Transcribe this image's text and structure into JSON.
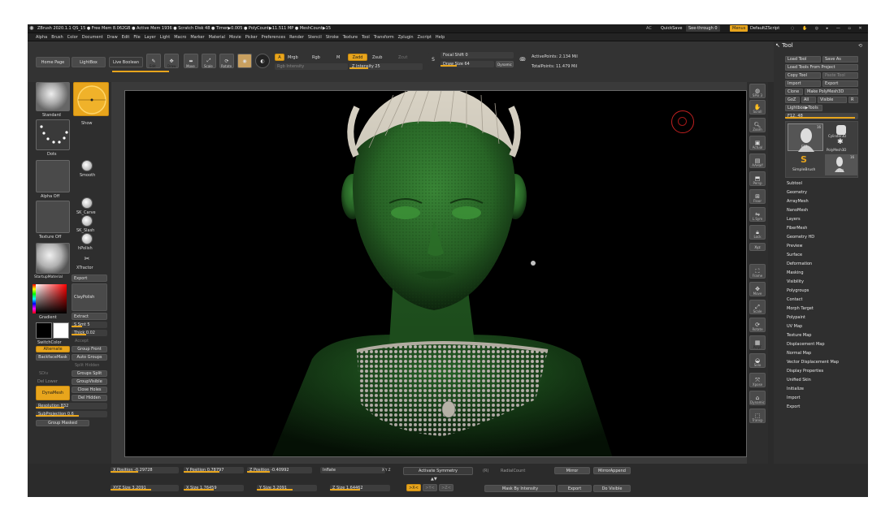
{
  "titlebar": {
    "title": "ZBrush 2020.1.1   QS_15   ● Free Mem 8.062GB ● Active Mem 1936 ● Scratch Disk 48 ● Timer▶0.005 ● PolyCount▶11.511 MP ● MeshCount▶15",
    "ac": "AC",
    "quicksave": "QuickSave",
    "seethrough": "See-through 0",
    "menus": "Menus",
    "default_zscript": "DefaultZScript"
  },
  "menubar": [
    "Alpha",
    "Brush",
    "Color",
    "Document",
    "Draw",
    "Edit",
    "File",
    "Layer",
    "Light",
    "Macro",
    "Marker",
    "Material",
    "Movie",
    "Picker",
    "Preferences",
    "Render",
    "Stencil",
    "Stroke",
    "Texture",
    "Tool",
    "Transform",
    "Zplugin",
    "Zscript",
    "Help"
  ],
  "shelf": {
    "home_page": "Home Page",
    "lightbox": "LightBox",
    "live_boolean": "Live Boolean",
    "edit": "Edit",
    "draw": "Draw",
    "move": "Move",
    "scale": "Scale",
    "rotate": "Rotate",
    "a": "A",
    "mrgb": "Mrgb",
    "rgb": "Rgb",
    "m": "M",
    "zadd": "Zadd",
    "zsub": "Zsub",
    "zcut": "Zcut",
    "rgb_intensity": "Rgb Intensity",
    "z_intensity": "Z Intensity 25",
    "z_intensity_value": 0.25,
    "focal_shift": "Focal Shift 0",
    "draw_size": "Draw Size 64",
    "dynamic": "Dynamic",
    "active_points": "ActivePoints: 2.134 Mil",
    "total_points": "TotalPoints: 11.479 Mil"
  },
  "left": {
    "brush_name": "Standard",
    "stroke_name": "Dots",
    "alpha_name": "Alpha Off",
    "texture_name": "Texture Off",
    "material_name": "StartupMaterial",
    "gradient": "Gradient",
    "switch_color": "SwitchColor",
    "alternate": "Alternate",
    "show": "Show",
    "smooth": "Smooth",
    "sk_carve": "SK_Carve",
    "sk_slash": "SK_Slash",
    "hpolish": "hPolish",
    "xtractor": "XTractor",
    "export": "Export",
    "claypolish": "ClayPolish",
    "extract": "Extract",
    "s_smt": "S Smt 5",
    "thick": "Thick 0.02",
    "accept": "Accept",
    "group_front": "Group Front",
    "backface_mask": "BackfaceMask",
    "auto_groups": "Auto Groups",
    "split_hidden": "Split Hidden",
    "sdiv": "SDiv",
    "groups_split": "Groups Split",
    "del_lower": "Del Lower",
    "group_visible": "GroupVisible",
    "close_holes": "Close Holes",
    "dynamesh": "DynaMesh",
    "del_hidden": "Del Hidden",
    "resolution": "Resolution 832",
    "subprojection": "SubProjection 0.6",
    "group_masked": "Group Masked"
  },
  "right_icons": [
    "SPix 3",
    "Scroll",
    "Zoom",
    "Actual",
    "AAHalf",
    "Persp",
    "Floor",
    "L.Sym",
    "Lock",
    "Xyz",
    "Frame",
    "Move",
    "Scale",
    "Rotate",
    "PolyF",
    "Solo",
    "Xpose",
    "Dynamic",
    "Transp"
  ],
  "tool_panel": {
    "header": "Tool",
    "load_tool": "Load Tool",
    "save_as": "Save As",
    "load_from_project": "Load Tools From Project",
    "copy_tool": "Copy Tool",
    "paste_tool": "Paste Tool",
    "import": "Import",
    "export": "Export",
    "clone": "Clone",
    "make_polymesh": "Make PolyMesh3D",
    "goz": "GoZ",
    "all": "All",
    "visible": "Visible",
    "r": "R",
    "lightbox_tools": "Lightbox▶Tools",
    "current_tool": "F12. 48",
    "thumb1": "F12",
    "thumb2": "Cylinder3D",
    "thumb3": "PolyMesh3D",
    "thumb4": "SimpleBrush",
    "thumb5": "F12",
    "badge1": "16",
    "badge2": "16",
    "items": [
      "Subtool",
      "Geometry",
      "ArrayMesh",
      "NanoMesh",
      "Layers",
      "FiberMesh",
      "Geometry HD",
      "Preview",
      "Surface",
      "Deformation",
      "Masking",
      "Visibility",
      "Polygroups",
      "Contact",
      "Morph Target",
      "Polypaint",
      "UV Map",
      "Texture Map",
      "Displacement Map",
      "Normal Map",
      "Vector Displacement Map",
      "Display Properties",
      "Unified Skin",
      "Initialize",
      "Import",
      "Export"
    ]
  },
  "bottom": {
    "x_position": "X Position -0.29728",
    "y_position": "Y Position 0.78797",
    "z_position": "Z Position -0.40992",
    "inflate": "Inflate",
    "xyz": "X Y Z",
    "activate_symmetry": "Activate Symmetry",
    "r_label": "(R)",
    "radial_count": "RadialCount",
    "mirror": "Mirror",
    "mirror_and_append": "MirrorAppend",
    "xyz_size": "XYZ Size 3.2091",
    "x_size": "X Size 1.76459",
    "y_size": "Y Size 3.2091",
    "z_size": "Z Size 1.64462",
    "sym_x": ">X<",
    "sym_y": ">Y<",
    "sym_z": ">Z<",
    "mask_by_intensity": "Mask By Intensity",
    "export": "Export",
    "do_visible": "Do Visible"
  },
  "colors": {
    "accent": "#e8a51c",
    "skin": "#2e7a2e",
    "hair": "#d8d2c4"
  }
}
